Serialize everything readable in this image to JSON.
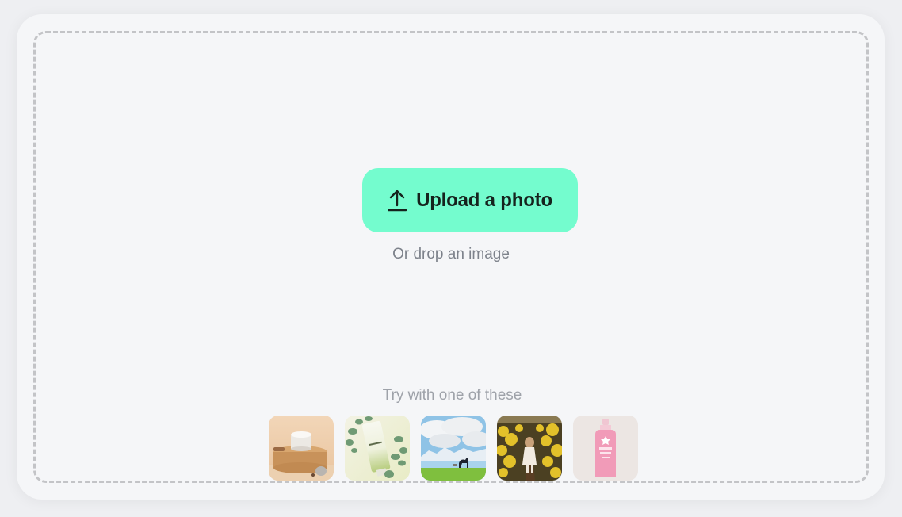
{
  "upload": {
    "button_label": "Upload a photo",
    "icon": "upload-arrow-icon",
    "accent_color": "#74fcce",
    "hint": "Or drop an image"
  },
  "samples": {
    "title": "Try with one of these",
    "items": [
      {
        "name": "cream-jar-on-cork",
        "description": "White cosmetic jar on a cork pedestal"
      },
      {
        "name": "tube-with-eucalyptus",
        "description": "Green cosmetic tube with eucalyptus leaves"
      },
      {
        "name": "horse-in-field",
        "description": "Horse grazing in green field under clouds and mountains"
      },
      {
        "name": "girl-in-flower-field",
        "description": "Child walking through yellow rapeseed field"
      },
      {
        "name": "pink-lotion-bottle",
        "description": "Pink pump bottle labeled Saltair Beach"
      }
    ]
  }
}
